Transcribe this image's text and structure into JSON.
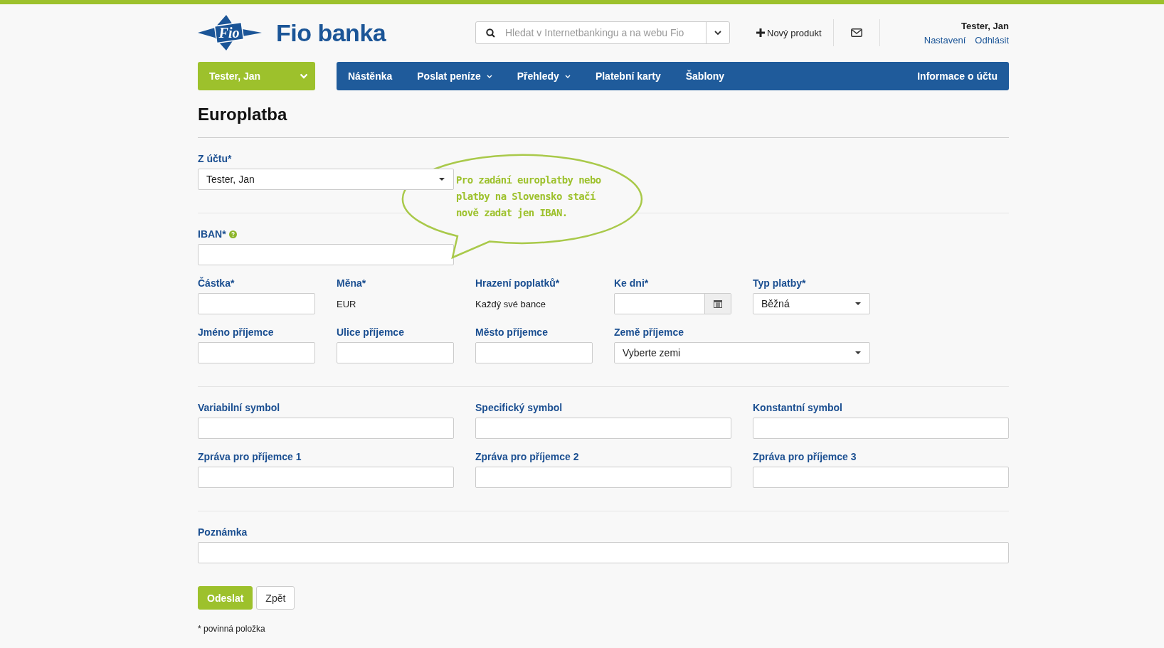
{
  "header": {
    "logo_mark": "Fio",
    "logo_text": "Fio banka",
    "search": {
      "placeholder": "Hledat v Internetbankingu a na webu Fio"
    },
    "new_product": "Nový produkt",
    "user": {
      "name": "Tester, Jan",
      "links": [
        "Nastavení",
        "Odhlásit"
      ]
    }
  },
  "nav": {
    "account": "Tester, Jan",
    "items": [
      {
        "label": "Nástěnka",
        "has_menu": false
      },
      {
        "label": "Poslat peníze",
        "has_menu": true
      },
      {
        "label": "Přehledy",
        "has_menu": true
      },
      {
        "label": "Platební karty",
        "has_menu": false
      },
      {
        "label": "Šablony",
        "has_menu": false
      }
    ],
    "right_item": "Informace o účtu"
  },
  "page_title": "Europlatba",
  "callout": "Pro zadání europlatby nebo platby na Slovensko stačí nově zadat jen IBAN.",
  "sections": [
    {
      "rows": [
        [
          {
            "kind": "select-wide",
            "label": "Z účtu*",
            "value": "Tester, Jan"
          }
        ]
      ]
    },
    {
      "rows": [
        [
          {
            "kind": "input-wide",
            "label": "IBAN*",
            "help": true
          }
        ],
        [
          {
            "kind": "input",
            "label": "Částka*"
          },
          {
            "kind": "static",
            "label": "Měna*",
            "value": "EUR"
          },
          {
            "kind": "static",
            "label": "Hrazení poplatků*",
            "value": "Každý své bance"
          },
          {
            "kind": "date",
            "label": "Ke dni*"
          },
          {
            "kind": "select",
            "label": "Typ platby*",
            "value": "Běžná"
          }
        ],
        [
          {
            "kind": "input",
            "label": "Jméno příjemce"
          },
          {
            "kind": "input",
            "label": "Ulice příjemce"
          },
          {
            "kind": "input",
            "label": "Město příjemce"
          },
          {
            "kind": "select-wide",
            "label": "Země příjemce",
            "value": "Vyberte zemi"
          }
        ]
      ]
    },
    {
      "rows": [
        [
          {
            "kind": "input-wide",
            "label": "Variabilní symbol"
          },
          {
            "kind": "input-wide",
            "label": "Specifický symbol"
          },
          {
            "kind": "input-wide",
            "label": "Konstantní symbol"
          }
        ],
        [
          {
            "kind": "input-wide",
            "label": "Zpráva pro příjemce 1"
          },
          {
            "kind": "input-wide",
            "label": "Zpráva pro příjemce 2"
          },
          {
            "kind": "input-wide",
            "label": "Zpráva pro příjemce 3"
          }
        ]
      ]
    },
    {
      "rows": [
        [
          {
            "kind": "input-full",
            "label": "Poznámka"
          }
        ]
      ]
    }
  ],
  "buttons": [
    {
      "label": "Odeslat",
      "kind": "primary"
    },
    {
      "label": "Zpět",
      "kind": "default"
    }
  ],
  "footnote": "* povinná položka"
}
